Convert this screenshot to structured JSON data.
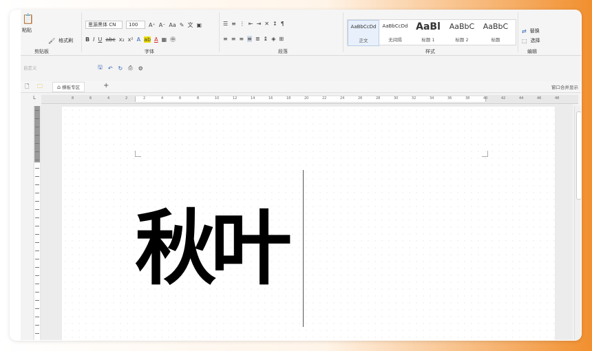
{
  "ribbon": {
    "clipboard": {
      "paste_label": "粘贴",
      "format_painter_label": "格式刷",
      "group_label": "剪贴板"
    },
    "font": {
      "font_name": "思源黑体 CN",
      "font_size": "100",
      "group_label": "字体",
      "aa_label": "Aa"
    },
    "paragraph": {
      "group_label": "段落"
    },
    "styles": {
      "group_label": "样式",
      "items": [
        {
          "preview": "AaBbCcDd",
          "name": "正文"
        },
        {
          "preview": "AaBbCcDd",
          "name": "无间隔"
        },
        {
          "preview": "AaBl",
          "name": "标题 1"
        },
        {
          "preview": "AaBbC",
          "name": "标题 2"
        },
        {
          "preview": "AaBbC",
          "name": "标题"
        }
      ]
    },
    "editing": {
      "replace_label": "替换",
      "select_label": "选择",
      "group_label": "编辑"
    }
  },
  "quick_access": {
    "placeholder": "自定义"
  },
  "tabbar": {
    "tab_label": "横板专区",
    "add_label": "+",
    "right_label": "窗口合并显示"
  },
  "ruler": {
    "ticks": [
      "8",
      "6",
      "4",
      "2",
      "2",
      "4",
      "6",
      "8",
      "10",
      "12",
      "14",
      "16",
      "18",
      "20",
      "22",
      "24",
      "26",
      "28",
      "30",
      "32",
      "34",
      "36",
      "38",
      "40",
      "42",
      "44",
      "46",
      "48"
    ]
  },
  "document": {
    "text": "秋叶"
  },
  "colors": {
    "accent": "#2b5fb4",
    "font_color": "#d02020",
    "highlight": "#f0e000"
  }
}
